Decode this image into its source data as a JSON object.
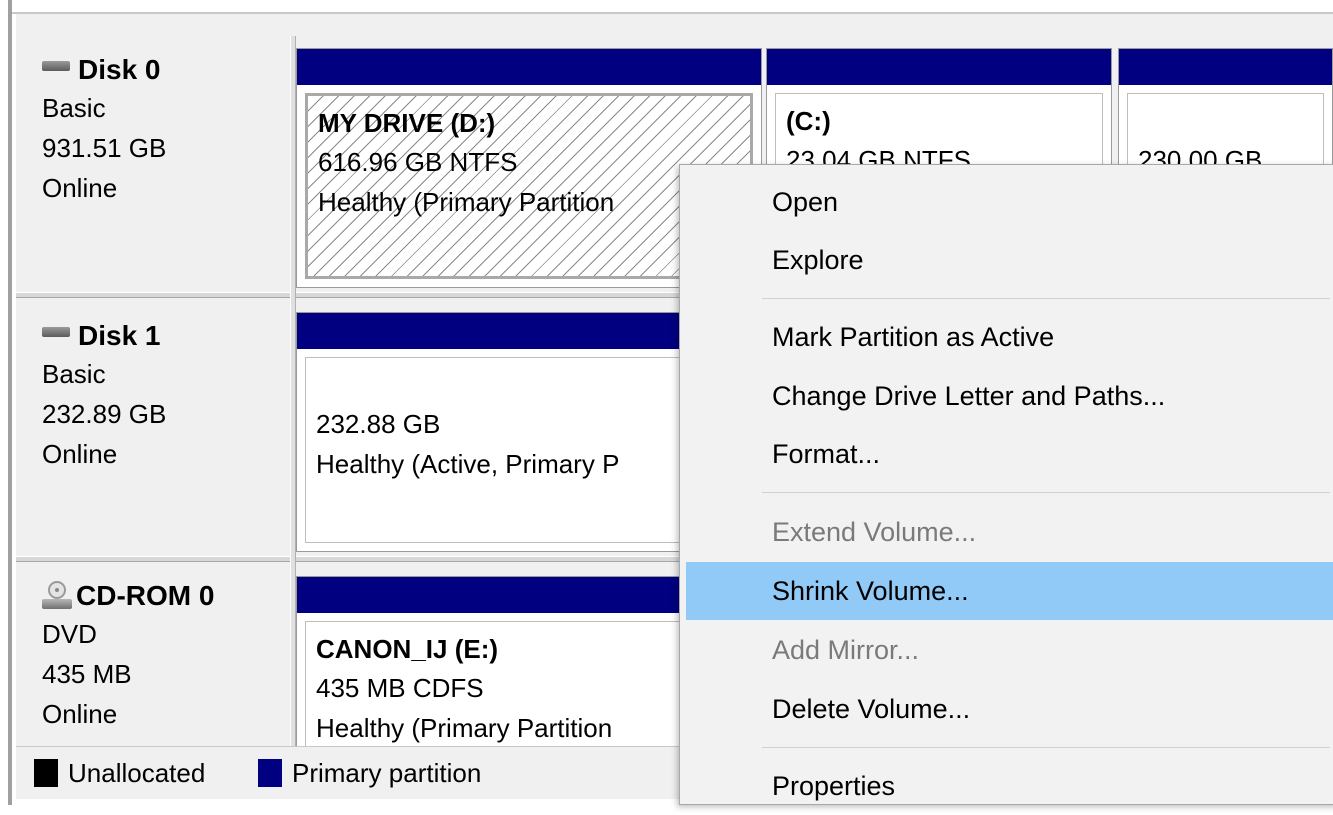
{
  "disks": [
    {
      "name": "Disk 0",
      "type": "Basic",
      "size": "931.51 GB",
      "status": "Online",
      "icon": "hard-disk-icon"
    },
    {
      "name": "Disk 1",
      "type": "Basic",
      "size": "232.89 GB",
      "status": "Online",
      "icon": "hard-disk-icon"
    },
    {
      "name": "CD-ROM 0",
      "type": "DVD",
      "size": "435 MB",
      "status": "Online",
      "icon": "cd-drive-icon"
    }
  ],
  "partitions": {
    "d_drive": {
      "title": "MY DRIVE  (D:)",
      "size": "616.96 GB NTFS",
      "health": "Healthy (Primary Partition"
    },
    "c_drive": {
      "title": "(C:)",
      "size": "23.04 GB NTFS"
    },
    "third": {
      "size": "230.00 GB"
    },
    "disk1_part": {
      "size": "232.88 GB",
      "health": "Healthy (Active, Primary P"
    },
    "e_drive": {
      "title": "CANON_IJ  (E:)",
      "size": "435 MB CDFS",
      "health": "Healthy (Primary Partition"
    }
  },
  "legend": [
    {
      "label": "Unallocated",
      "color": "#000000"
    },
    {
      "label": "Primary partition",
      "color": "#000080"
    }
  ],
  "context_menu": {
    "items": [
      {
        "label": "Open",
        "enabled": true
      },
      {
        "label": "Explore",
        "enabled": true
      },
      {
        "label": "Mark Partition as Active",
        "enabled": true
      },
      {
        "label": "Change Drive Letter and Paths...",
        "enabled": true
      },
      {
        "label": "Format...",
        "enabled": true
      },
      {
        "label": "Extend Volume...",
        "enabled": false
      },
      {
        "label": "Shrink Volume...",
        "enabled": true,
        "highlighted": true
      },
      {
        "label": "Add Mirror...",
        "enabled": false
      },
      {
        "label": "Delete Volume...",
        "enabled": true
      },
      {
        "label": "Properties",
        "enabled": true
      }
    ]
  },
  "colors": {
    "partition_bar": "#000080",
    "menu_highlight": "#91c9f7",
    "disabled_text": "#7a7a7a"
  }
}
